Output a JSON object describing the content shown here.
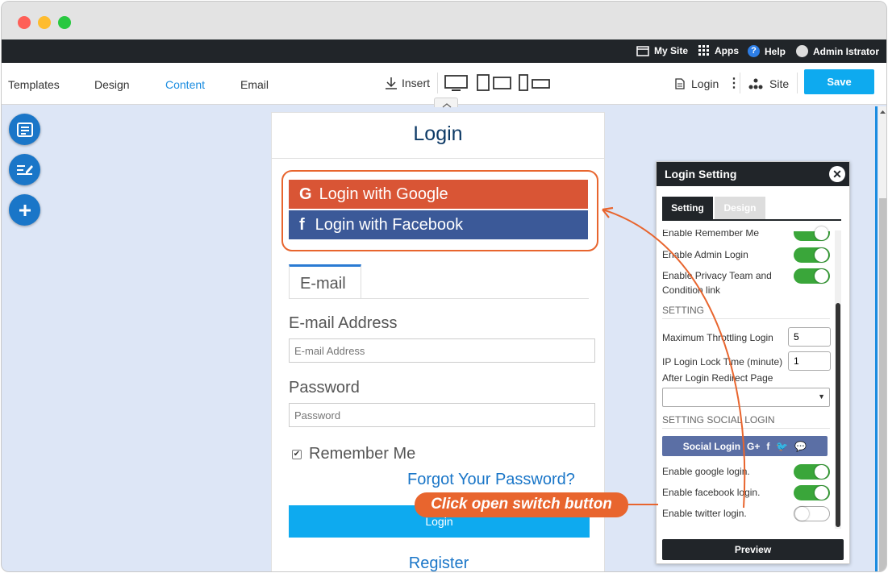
{
  "window": {
    "controls": [
      "close",
      "minimize",
      "maximize"
    ]
  },
  "topbar": {
    "my_site": "My Site",
    "apps": "Apps",
    "help": "Help",
    "user": "Admin Istrator"
  },
  "toolbar": {
    "tabs": [
      {
        "label": "Templates"
      },
      {
        "label": "Design"
      },
      {
        "label": "Content",
        "active": true
      },
      {
        "label": "Email"
      }
    ],
    "insert": "Insert",
    "page_name": "Login",
    "site": "Site",
    "save": "Save"
  },
  "page": {
    "title": "Login",
    "google_button": "Login with Google",
    "facebook_button": "Login with Facebook",
    "tab_email": "E-mail",
    "email_label": "E-mail Address",
    "email_placeholder": "E-mail Address",
    "password_label": "Password",
    "password_placeholder": "Password",
    "remember_me": "Remember Me",
    "forgot": "Forgot Your Password?",
    "login_button": "Login",
    "register": "Register"
  },
  "callout": "Click open switch button",
  "panel": {
    "title": "Login Setting",
    "tab_setting": "Setting",
    "tab_design": "Design",
    "rows": [
      {
        "label": "Enable Remember Me",
        "on": true
      },
      {
        "label": "Enable Admin Login",
        "on": true
      },
      {
        "label": "Enable Privacy Team and Condition link",
        "on": true
      }
    ],
    "section_setting": "SETTING",
    "max_throttling_label": "Maximum Throttling Login",
    "max_throttling_value": "5",
    "ip_lock_label": "IP Login Lock Time (minute)",
    "ip_lock_value": "1",
    "redirect_label": "After Login Redirect Page",
    "section_social": "SETTING SOCIAL LOGIN",
    "social_login_button": "Social Login",
    "social_rows": [
      {
        "label": "Enable google login.",
        "on": true
      },
      {
        "label": "Enable facebook login.",
        "on": true
      },
      {
        "label": "Enable twitter login.",
        "on": false
      }
    ],
    "preview": "Preview"
  },
  "colors": {
    "google": "#d95535",
    "facebook": "#3b5998",
    "accent": "#0eaaef",
    "annotation": "#e8652e",
    "switch_on": "#3aa63a"
  }
}
